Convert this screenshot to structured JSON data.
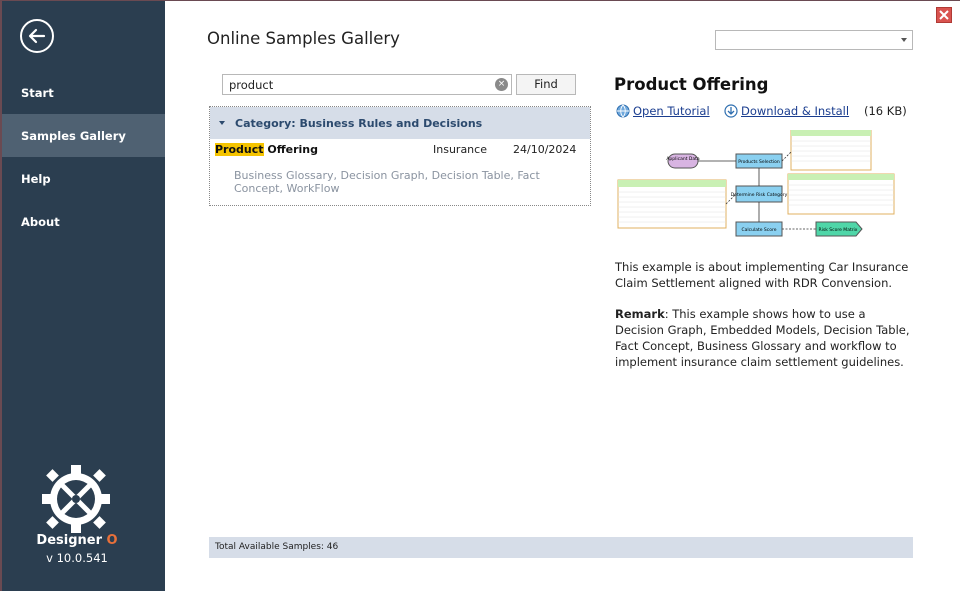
{
  "header": {
    "title": "Online Samples Gallery",
    "combo_value": ""
  },
  "sidebar": {
    "items": [
      {
        "label": "Start"
      },
      {
        "label": "Samples Gallery"
      },
      {
        "label": "Help"
      },
      {
        "label": "About"
      }
    ],
    "brand_name": "Designer",
    "brand_suffix": "O",
    "version": "v 10.0.541"
  },
  "search": {
    "value": "product",
    "find_label": "Find"
  },
  "results": {
    "category_label": "Category: Business Rules and Decisions",
    "rows": [
      {
        "title_highlight": "Product",
        "title_rest": " Offering",
        "category": "Insurance",
        "date": "24/10/2024",
        "tags": "Business Glossary, Decision Graph, Decision Table, Fact Concept, WorkFlow"
      }
    ]
  },
  "detail": {
    "title": "Product Offering",
    "open_tutorial": "Open Tutorial",
    "download": "Download & Install",
    "size": "(16 KB)",
    "description": "This example is about implementing Car Insurance Claim Settlement aligned with RDR Convension.",
    "remark_label": "Remark",
    "remark_text": ": This example shows how to use a Decision Graph, Embedded Models, Decision Table, Fact Concept, Business Glossary and workflow to implement insurance claim settlement guidelines.",
    "diagram": {
      "applicant_data": "Applicant Data",
      "products_selection": "Products Selection",
      "determine_risk": "Determine Risk Category",
      "calculate_score": "Calculate Score",
      "risk_score_matrix": "Risk Score Matrix"
    }
  },
  "status": {
    "text": "Total Available Samples: 46"
  },
  "colors": {
    "sidebar": "#2b3e50",
    "sidebar_active": "#4f6172",
    "accent": "#e8703a",
    "highlight": "#f5c400"
  }
}
